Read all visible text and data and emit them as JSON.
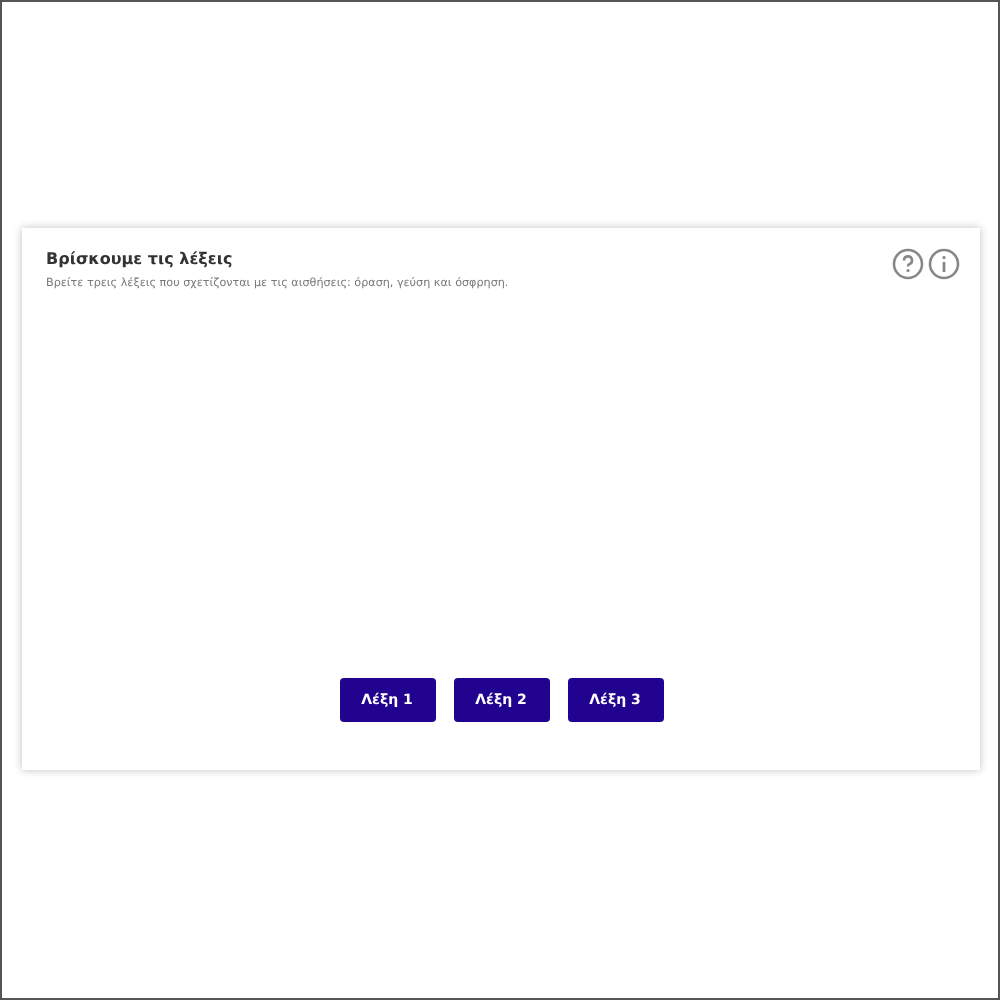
{
  "activity": {
    "title": "Βρίσκουμε τις λέξεις",
    "instructions": "Βρείτε τρεις λέξεις που σχετίζονται με τις αισθήσεις: όραση, γεύση και όσφρηση.",
    "buttons": [
      "Λέξη 1",
      "Λέξη 2",
      "Λέξη 3"
    ]
  }
}
